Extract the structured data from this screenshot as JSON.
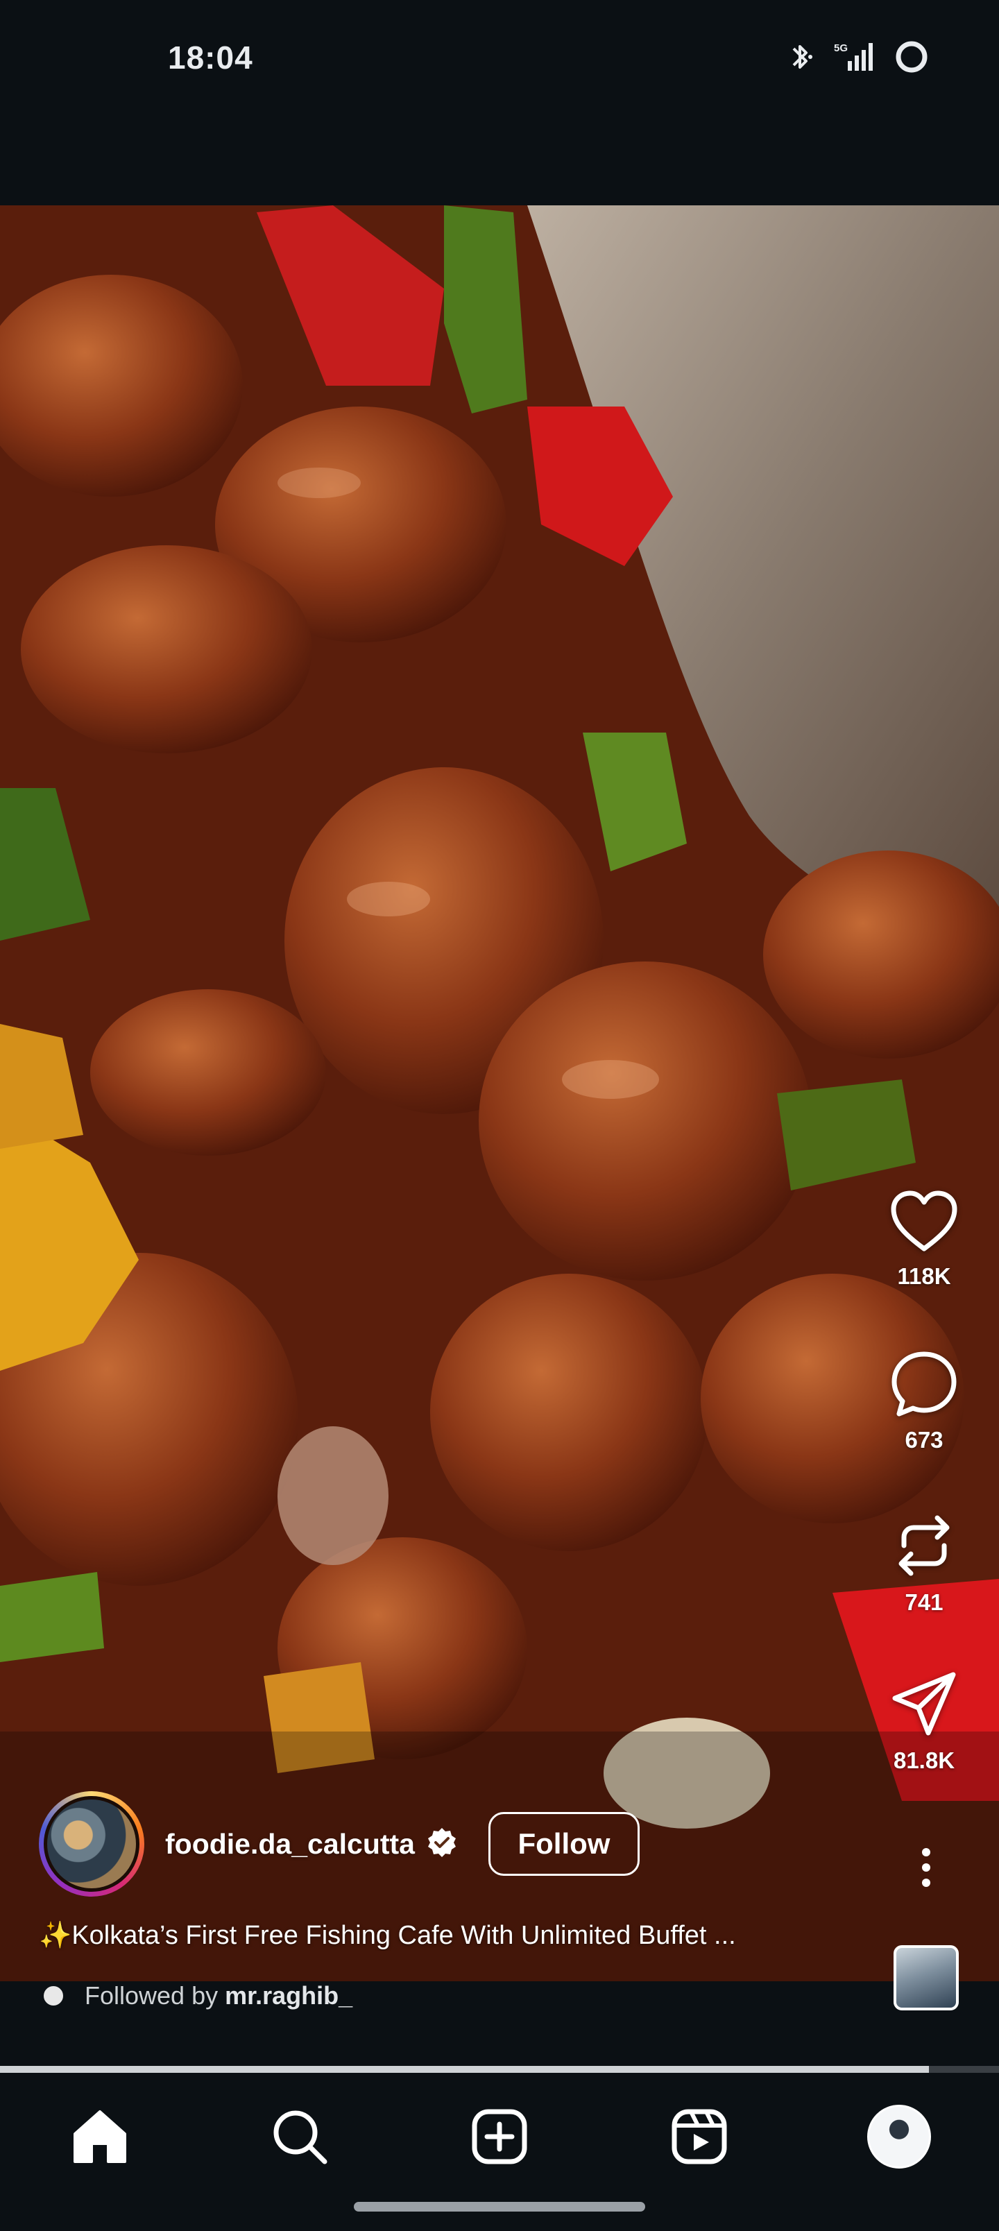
{
  "status_bar": {
    "time": "18:04",
    "icons": [
      "bluetooth-icon",
      "5g-signal-icon",
      "loading-ring-icon"
    ]
  },
  "reel": {
    "author": {
      "username": "foodie.da_calcutta",
      "verified": true,
      "follow_label": "Follow"
    },
    "caption": "✨Kolkata’s First Free Fishing Cafe With Unlimited Buffet ...",
    "followed_by": {
      "prefix": "Followed by",
      "name": "mr.raghib_"
    },
    "actions": {
      "likes": "118K",
      "comments": "673",
      "reposts": "741",
      "shares": "81.8K"
    },
    "playback_progress": 0.93
  },
  "bottom_nav": {
    "items": [
      "home-icon",
      "search-icon",
      "create-icon",
      "reels-icon",
      "profile-avatar"
    ],
    "active": "home-icon"
  },
  "colors": {
    "background": "#0b1014",
    "accent_ring": "#d62976",
    "text": "#ffffff"
  }
}
